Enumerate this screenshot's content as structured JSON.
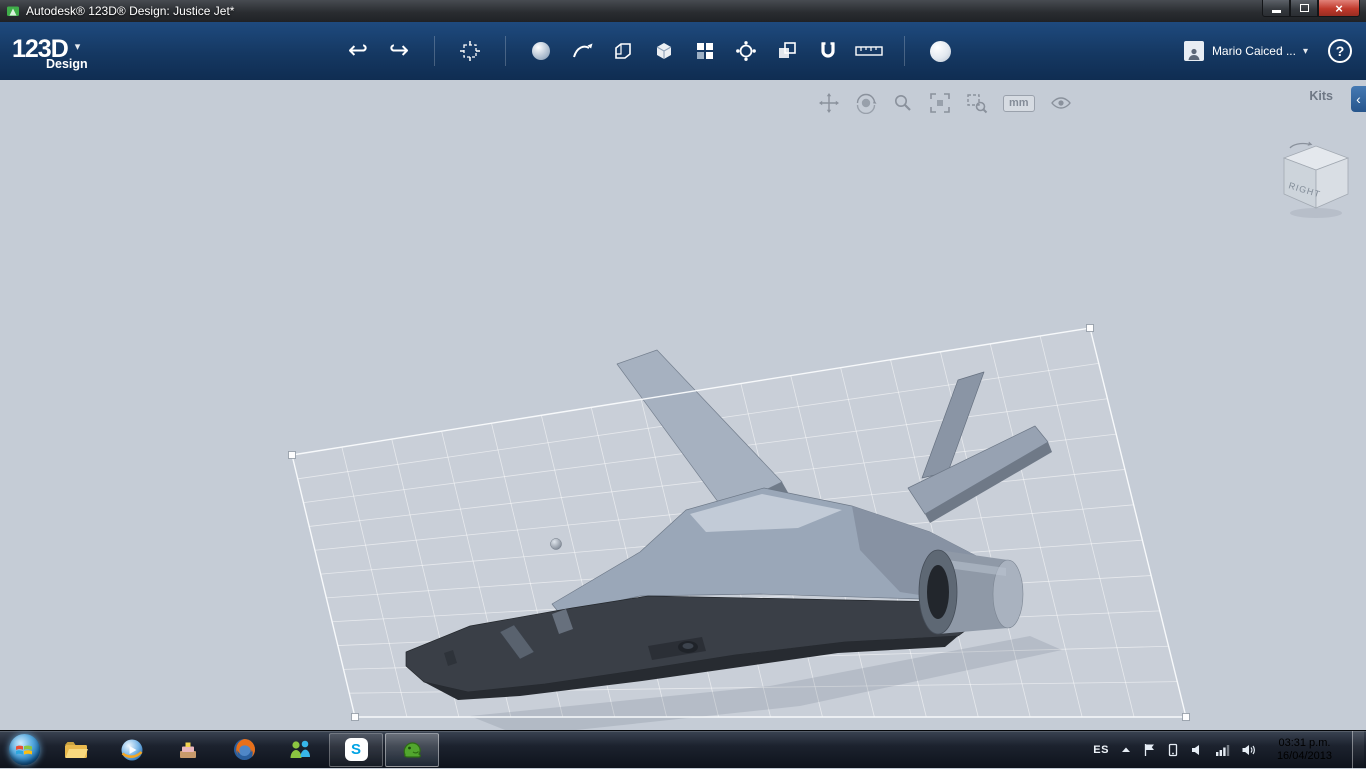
{
  "window": {
    "title": "Autodesk® 123D® Design: Justice Jet*",
    "close_glyph": "×"
  },
  "appbar": {
    "logo_text": "123D",
    "logo_chevron": "▾",
    "logo_subtitle": "Design",
    "tools": [
      {
        "name": "undo",
        "glyph": "↩"
      },
      {
        "name": "redo",
        "glyph": "↪"
      },
      {
        "name": "transform"
      },
      {
        "name": "primitives"
      },
      {
        "name": "sketch"
      },
      {
        "name": "chamfer"
      },
      {
        "name": "box"
      },
      {
        "name": "pattern"
      },
      {
        "name": "circular-pattern"
      },
      {
        "name": "combine"
      },
      {
        "name": "snap"
      },
      {
        "name": "measure"
      },
      {
        "name": "material"
      }
    ],
    "user_name": "Mario Caiced ...",
    "user_chevron": "▾",
    "help_glyph": "?"
  },
  "viewport": {
    "nav_tools": [
      "pan",
      "orbit",
      "zoom",
      "zoom-fit",
      "zoom-window",
      "units",
      "visibility"
    ],
    "units_label": "mm",
    "kits_label": "Kits",
    "kits_chevron": "‹",
    "viewcube_face_label": "RIGHT"
  },
  "taskbar": {
    "skype_glyph": "S",
    "tray": {
      "language": "ES",
      "time": "03:31 p.m.",
      "date": "16/04/2013"
    }
  },
  "colors": {
    "appbar_bg": "#153862",
    "canvas_bg": "#c5ccd6",
    "hull_dark": "#3a3f47",
    "body_light": "#9aa7b8",
    "selection_white": "#f7f9fb",
    "close_button_red": "#c0392b",
    "kits_tab_blue": "#3b70ab"
  }
}
